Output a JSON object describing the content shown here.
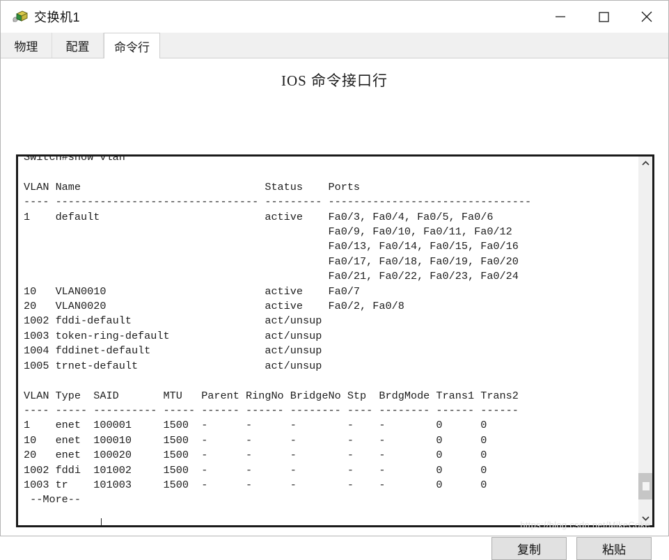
{
  "window": {
    "title": "交换机1",
    "icon": "switch-device-icon",
    "controls": {
      "minimize": "minimize-icon",
      "maximize": "maximize-icon",
      "close": "close-icon"
    }
  },
  "tabs": [
    {
      "label": "物理",
      "active": false
    },
    {
      "label": "配置",
      "active": false
    },
    {
      "label": "命令行",
      "active": true
    }
  ],
  "panel": {
    "title": "IOS 命令接口行"
  },
  "terminal": {
    "prompt_line": "Switch#show vlan",
    "more_prompt": "--More--",
    "cursor": true,
    "text": "Switch#show vlan\n\nVLAN Name                             Status    Ports\n---- -------------------------------- --------- --------------------------------\n1    default                          active    Fa0/3, Fa0/4, Fa0/5, Fa0/6\n                                                Fa0/9, Fa0/10, Fa0/11, Fa0/12\n                                                Fa0/13, Fa0/14, Fa0/15, Fa0/16\n                                                Fa0/17, Fa0/18, Fa0/19, Fa0/20\n                                                Fa0/21, Fa0/22, Fa0/23, Fa0/24\n10   VLAN0010                         active    Fa0/7\n20   VLAN0020                         active    Fa0/2, Fa0/8\n1002 fddi-default                     act/unsup\n1003 token-ring-default               act/unsup\n1004 fddinet-default                  act/unsup\n1005 trnet-default                    act/unsup\n\nVLAN Type  SAID       MTU   Parent RingNo BridgeNo Stp  BrdgMode Trans1 Trans2\n---- ----- ---------- ----- ------ ------ -------- ---- -------- ------ ------\n1    enet  100001     1500  -      -      -        -    -        0      0\n10   enet  100010     1500  -      -      -        -    -        0      0\n20   enet  100020     1500  -      -      -        -    -        0      0\n1002 fddi  101002     1500  -      -      -        -    -        0      0\n1003 tr    101003     1500  -      -      -        -    -        0      0\n --More--"
  },
  "vlan_table_1": {
    "headers": [
      "VLAN",
      "Name",
      "Status",
      "Ports"
    ],
    "rows": [
      {
        "vlan": "1",
        "name": "default",
        "status": "active",
        "ports": [
          "Fa0/3, Fa0/4, Fa0/5, Fa0/6",
          "Fa0/9, Fa0/10, Fa0/11, Fa0/12",
          "Fa0/13, Fa0/14, Fa0/15, Fa0/16",
          "Fa0/17, Fa0/18, Fa0/19, Fa0/20",
          "Fa0/21, Fa0/22, Fa0/23, Fa0/24"
        ]
      },
      {
        "vlan": "10",
        "name": "VLAN0010",
        "status": "active",
        "ports": [
          "Fa0/7"
        ]
      },
      {
        "vlan": "20",
        "name": "VLAN0020",
        "status": "active",
        "ports": [
          "Fa0/2, Fa0/8"
        ]
      },
      {
        "vlan": "1002",
        "name": "fddi-default",
        "status": "act/unsup",
        "ports": []
      },
      {
        "vlan": "1003",
        "name": "token-ring-default",
        "status": "act/unsup",
        "ports": []
      },
      {
        "vlan": "1004",
        "name": "fddinet-default",
        "status": "act/unsup",
        "ports": []
      },
      {
        "vlan": "1005",
        "name": "trnet-default",
        "status": "act/unsup",
        "ports": []
      }
    ]
  },
  "vlan_table_2": {
    "headers": [
      "VLAN",
      "Type",
      "SAID",
      "MTU",
      "Parent",
      "RingNo",
      "BridgeNo",
      "Stp",
      "BrdgMode",
      "Trans1",
      "Trans2"
    ],
    "rows": [
      [
        "1",
        "enet",
        "100001",
        "1500",
        "-",
        "-",
        "-",
        "-",
        "-",
        "0",
        "0"
      ],
      [
        "10",
        "enet",
        "100010",
        "1500",
        "-",
        "-",
        "-",
        "-",
        "-",
        "0",
        "0"
      ],
      [
        "20",
        "enet",
        "100020",
        "1500",
        "-",
        "-",
        "-",
        "-",
        "-",
        "0",
        "0"
      ],
      [
        "1002",
        "fddi",
        "101002",
        "1500",
        "-",
        "-",
        "-",
        "-",
        "-",
        "0",
        "0"
      ],
      [
        "1003",
        "tr",
        "101003",
        "1500",
        "-",
        "-",
        "-",
        "-",
        "-",
        "0",
        "0"
      ]
    ]
  },
  "scrollbar": {
    "up_arrow": "chevron-up-icon",
    "down_arrow": "chevron-down-icon"
  },
  "footer": {
    "copy_label": "复制",
    "paste_label": "粘贴"
  },
  "watermark": "https://blog.csdn.net/MikeCoke",
  "colors": {
    "terminal_text": "#1d1d1d",
    "button_face": "#e1e1e1",
    "tab_inactive": "#f0f0f0",
    "scroll_thumb": "#c6c6c6"
  }
}
